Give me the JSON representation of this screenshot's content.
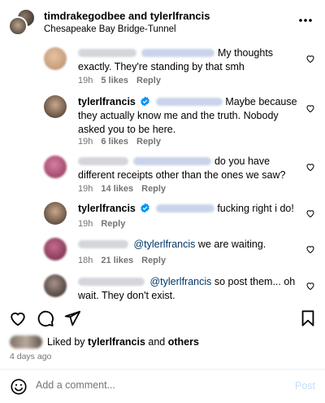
{
  "header": {
    "title": "timdrakegodbee and tylerlfrancis",
    "subtitle": "Chesapeake Bay Bridge-Tunnel"
  },
  "comments": [
    {
      "text": "My thoughts exactly. They're standing by that smh",
      "time": "19h",
      "likes": "5 likes",
      "reply": "Reply"
    },
    {
      "username": "tylerlfrancis",
      "text": "Maybe because they actually know me and the truth. Nobody asked you to be here.",
      "time": "19h",
      "likes": "6 likes",
      "reply": "Reply"
    },
    {
      "text": "do you have different receipts other than the ones we saw?",
      "time": "19h",
      "likes": "14 likes",
      "reply": "Reply"
    },
    {
      "username": "tylerlfrancis",
      "text": "fucking right i do!",
      "time": "19h",
      "reply": "Reply"
    },
    {
      "mention": "@tylerlfrancis",
      "text": "we are waiting.",
      "time": "18h",
      "likes": "21 likes",
      "reply": "Reply"
    },
    {
      "mention": "@tylerlfrancis",
      "text": "so post them... oh wait. They don't exist."
    }
  ],
  "likes": {
    "prefix": "Liked by",
    "user": "tylerlfrancis",
    "and": "and",
    "others": "others"
  },
  "date": "4 days ago",
  "add_comment": {
    "placeholder": "Add a comment...",
    "post_label": "Post"
  },
  "colors": {
    "meta": "#737373",
    "mention": "#00376b",
    "verified": "#0095f6",
    "post_disabled": "#c0dffd"
  },
  "icons": [
    "more-icon",
    "heart-icon",
    "comment-icon",
    "share-icon",
    "bookmark-icon",
    "verified-icon",
    "emoji-icon"
  ]
}
